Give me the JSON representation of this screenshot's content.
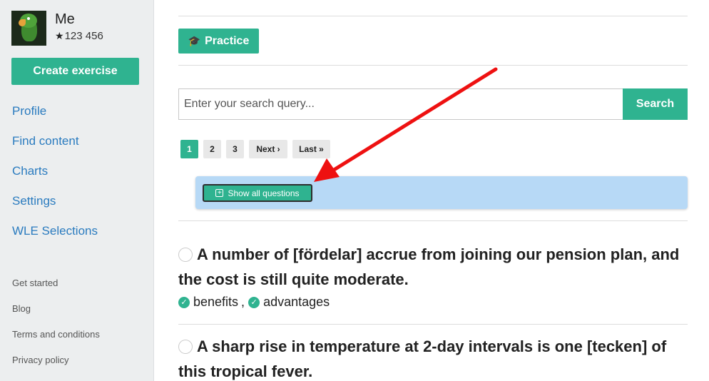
{
  "profile": {
    "name": "Me",
    "score": "123 456"
  },
  "sidebar": {
    "create_label": "Create exercise",
    "nav": [
      "Profile",
      "Find content",
      "Charts",
      "Settings",
      "WLE Selections"
    ],
    "footer": [
      "Get started",
      "Blog",
      "Terms and conditions",
      "Privacy policy"
    ]
  },
  "main": {
    "practice_label": "Practice",
    "search": {
      "placeholder": "Enter your search query...",
      "button_label": "Search"
    },
    "pager": {
      "pages": [
        "1",
        "2",
        "3"
      ],
      "next": "Next",
      "last": "Last"
    },
    "show_all_label": "Show all questions",
    "questions": [
      {
        "text": "A number of [fördelar] accrue from joining our pension plan, and the cost is still quite moderate.",
        "answers": [
          "benefits",
          "advantages"
        ]
      },
      {
        "text": "A sharp rise in temperature at 2-day intervals is one [tecken] of this tropical fever."
      }
    ]
  },
  "colors": {
    "accent": "#2fb390",
    "link": "#2a7bbf",
    "highlight_bar": "#b7d9f6",
    "annotation_arrow": "#ee1111"
  }
}
